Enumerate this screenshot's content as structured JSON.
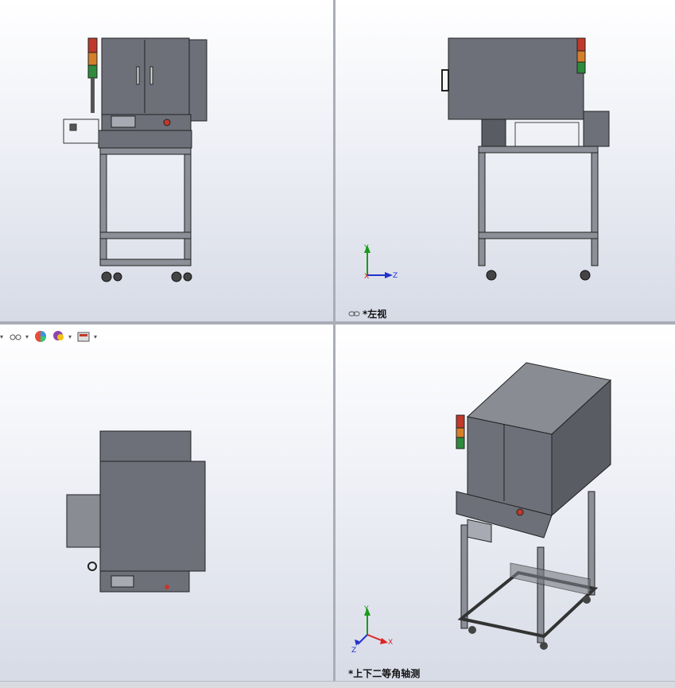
{
  "viewports": {
    "top_left": {
      "label": ""
    },
    "top_right": {
      "label": "*左视"
    },
    "bottom_left": {
      "label": ""
    },
    "bottom_right": {
      "label": "*上下二等角轴测"
    }
  },
  "triad": {
    "x": "X",
    "y": "Y",
    "z": "Z"
  },
  "heads_up_toolbar": {
    "items": [
      "view-orientation-icon",
      "display-style-icon",
      "appearance-icon",
      "scene-icon",
      "view-settings-icon"
    ]
  },
  "colors": {
    "machine_body": "#6e7079",
    "machine_dark": "#3c3d43",
    "frame": "#8c8f97",
    "lamp_red": "#c0392b",
    "lamp_amber": "#d4802a",
    "lamp_green": "#2e8b3e",
    "axis_x": "#d22",
    "axis_y": "#1a9a1a",
    "axis_z": "#2233cc"
  }
}
